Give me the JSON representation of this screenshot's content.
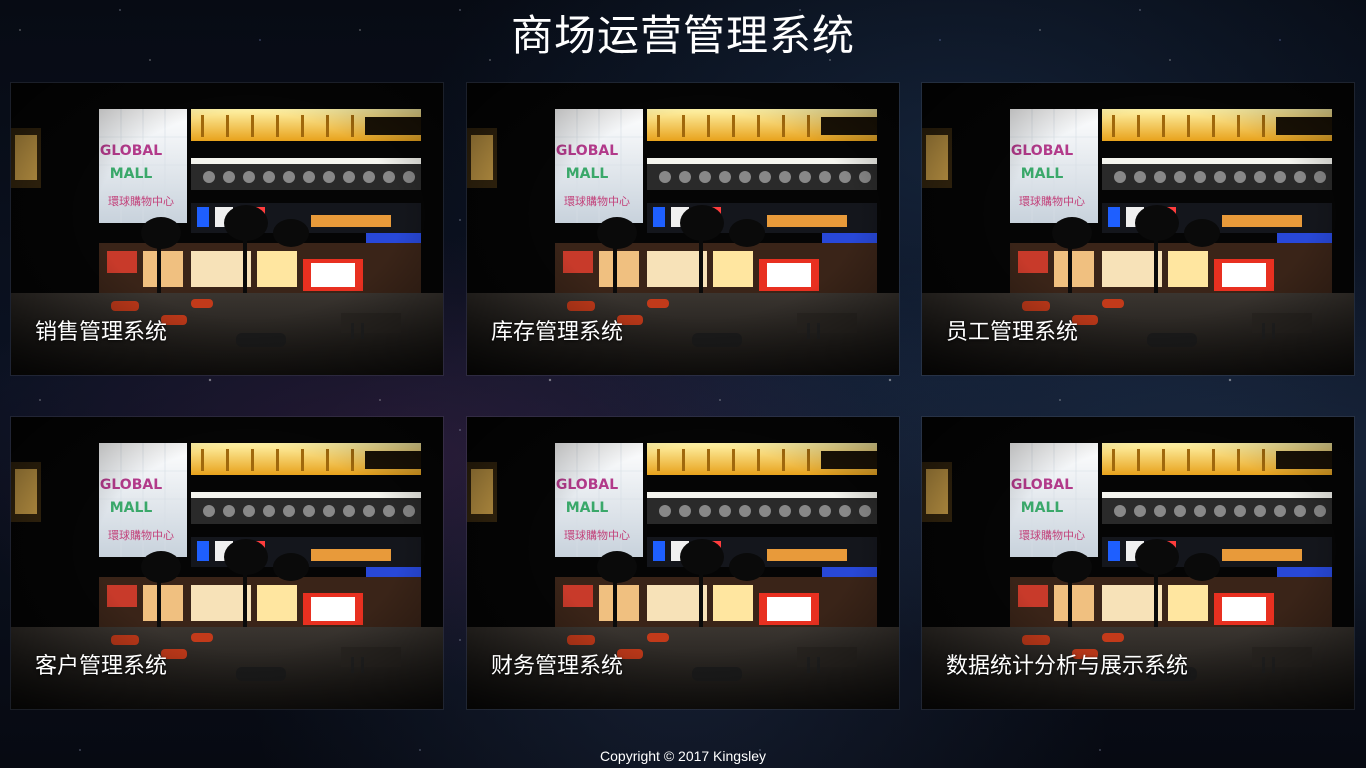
{
  "header": {
    "title": "商场运营管理系统"
  },
  "modules": [
    {
      "label": "销售管理系统"
    },
    {
      "label": "库存管理系统"
    },
    {
      "label": "员工管理系统"
    },
    {
      "label": "客户管理系统"
    },
    {
      "label": "财务管理系统"
    },
    {
      "label": "数据统计分析与展示系统"
    }
  ],
  "footer": {
    "copyright": "Copyright © 2017 Kingsley"
  },
  "thumbnail": {
    "sign_text_top": "GLOBAL",
    "sign_text_bottom": "MALL",
    "sign_text_cn": "環球購物中心"
  },
  "colors": {
    "background": "#0b1222",
    "text": "#ffffff"
  }
}
